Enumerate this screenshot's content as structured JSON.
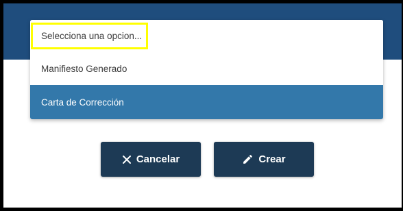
{
  "dropdown": {
    "placeholder": "Selecciona una opcion...",
    "options": [
      {
        "label": "Manifiesto Generado",
        "selected": false
      },
      {
        "label": "Carta de Corrección",
        "selected": true
      }
    ]
  },
  "actions": {
    "cancel_label": "Cancelar",
    "cancel_icon": "close-icon",
    "create_label": "Crear",
    "create_icon": "pencil-icon"
  },
  "colors": {
    "header": "#1f4d7d",
    "selected_option": "#3378aa",
    "button": "#1d3a55",
    "highlight": "#ffff00"
  }
}
